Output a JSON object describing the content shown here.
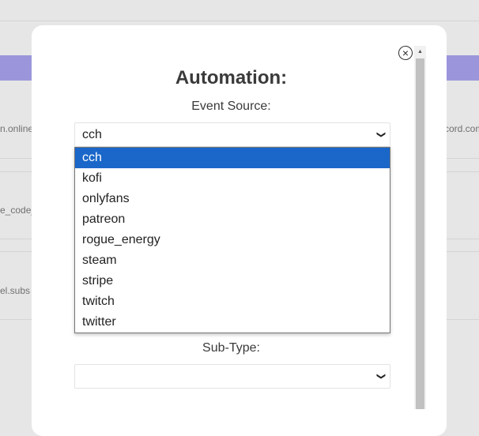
{
  "background": {
    "row_texts": [
      "n.online",
      "cord.com",
      "e_code_",
      "el.subs"
    ]
  },
  "modal": {
    "title": "Automation:",
    "close_glyph": "×",
    "event_source": {
      "label": "Event Source:",
      "selected": "cch",
      "options": [
        "cch",
        "kofi",
        "onlyfans",
        "patreon",
        "rogue_energy",
        "steam",
        "stripe",
        "twitch",
        "twitter"
      ],
      "selected_index": 0
    },
    "sub_type": {
      "label": "Sub-Type:",
      "selected": ""
    }
  },
  "icons": {
    "close": "close-circle-icon",
    "chevron": "chevron-down-icon",
    "scroll_up": "scroll-up-arrow-icon"
  },
  "colors": {
    "accent_band": "#9b96db",
    "selected_option": "#1a67c9"
  }
}
